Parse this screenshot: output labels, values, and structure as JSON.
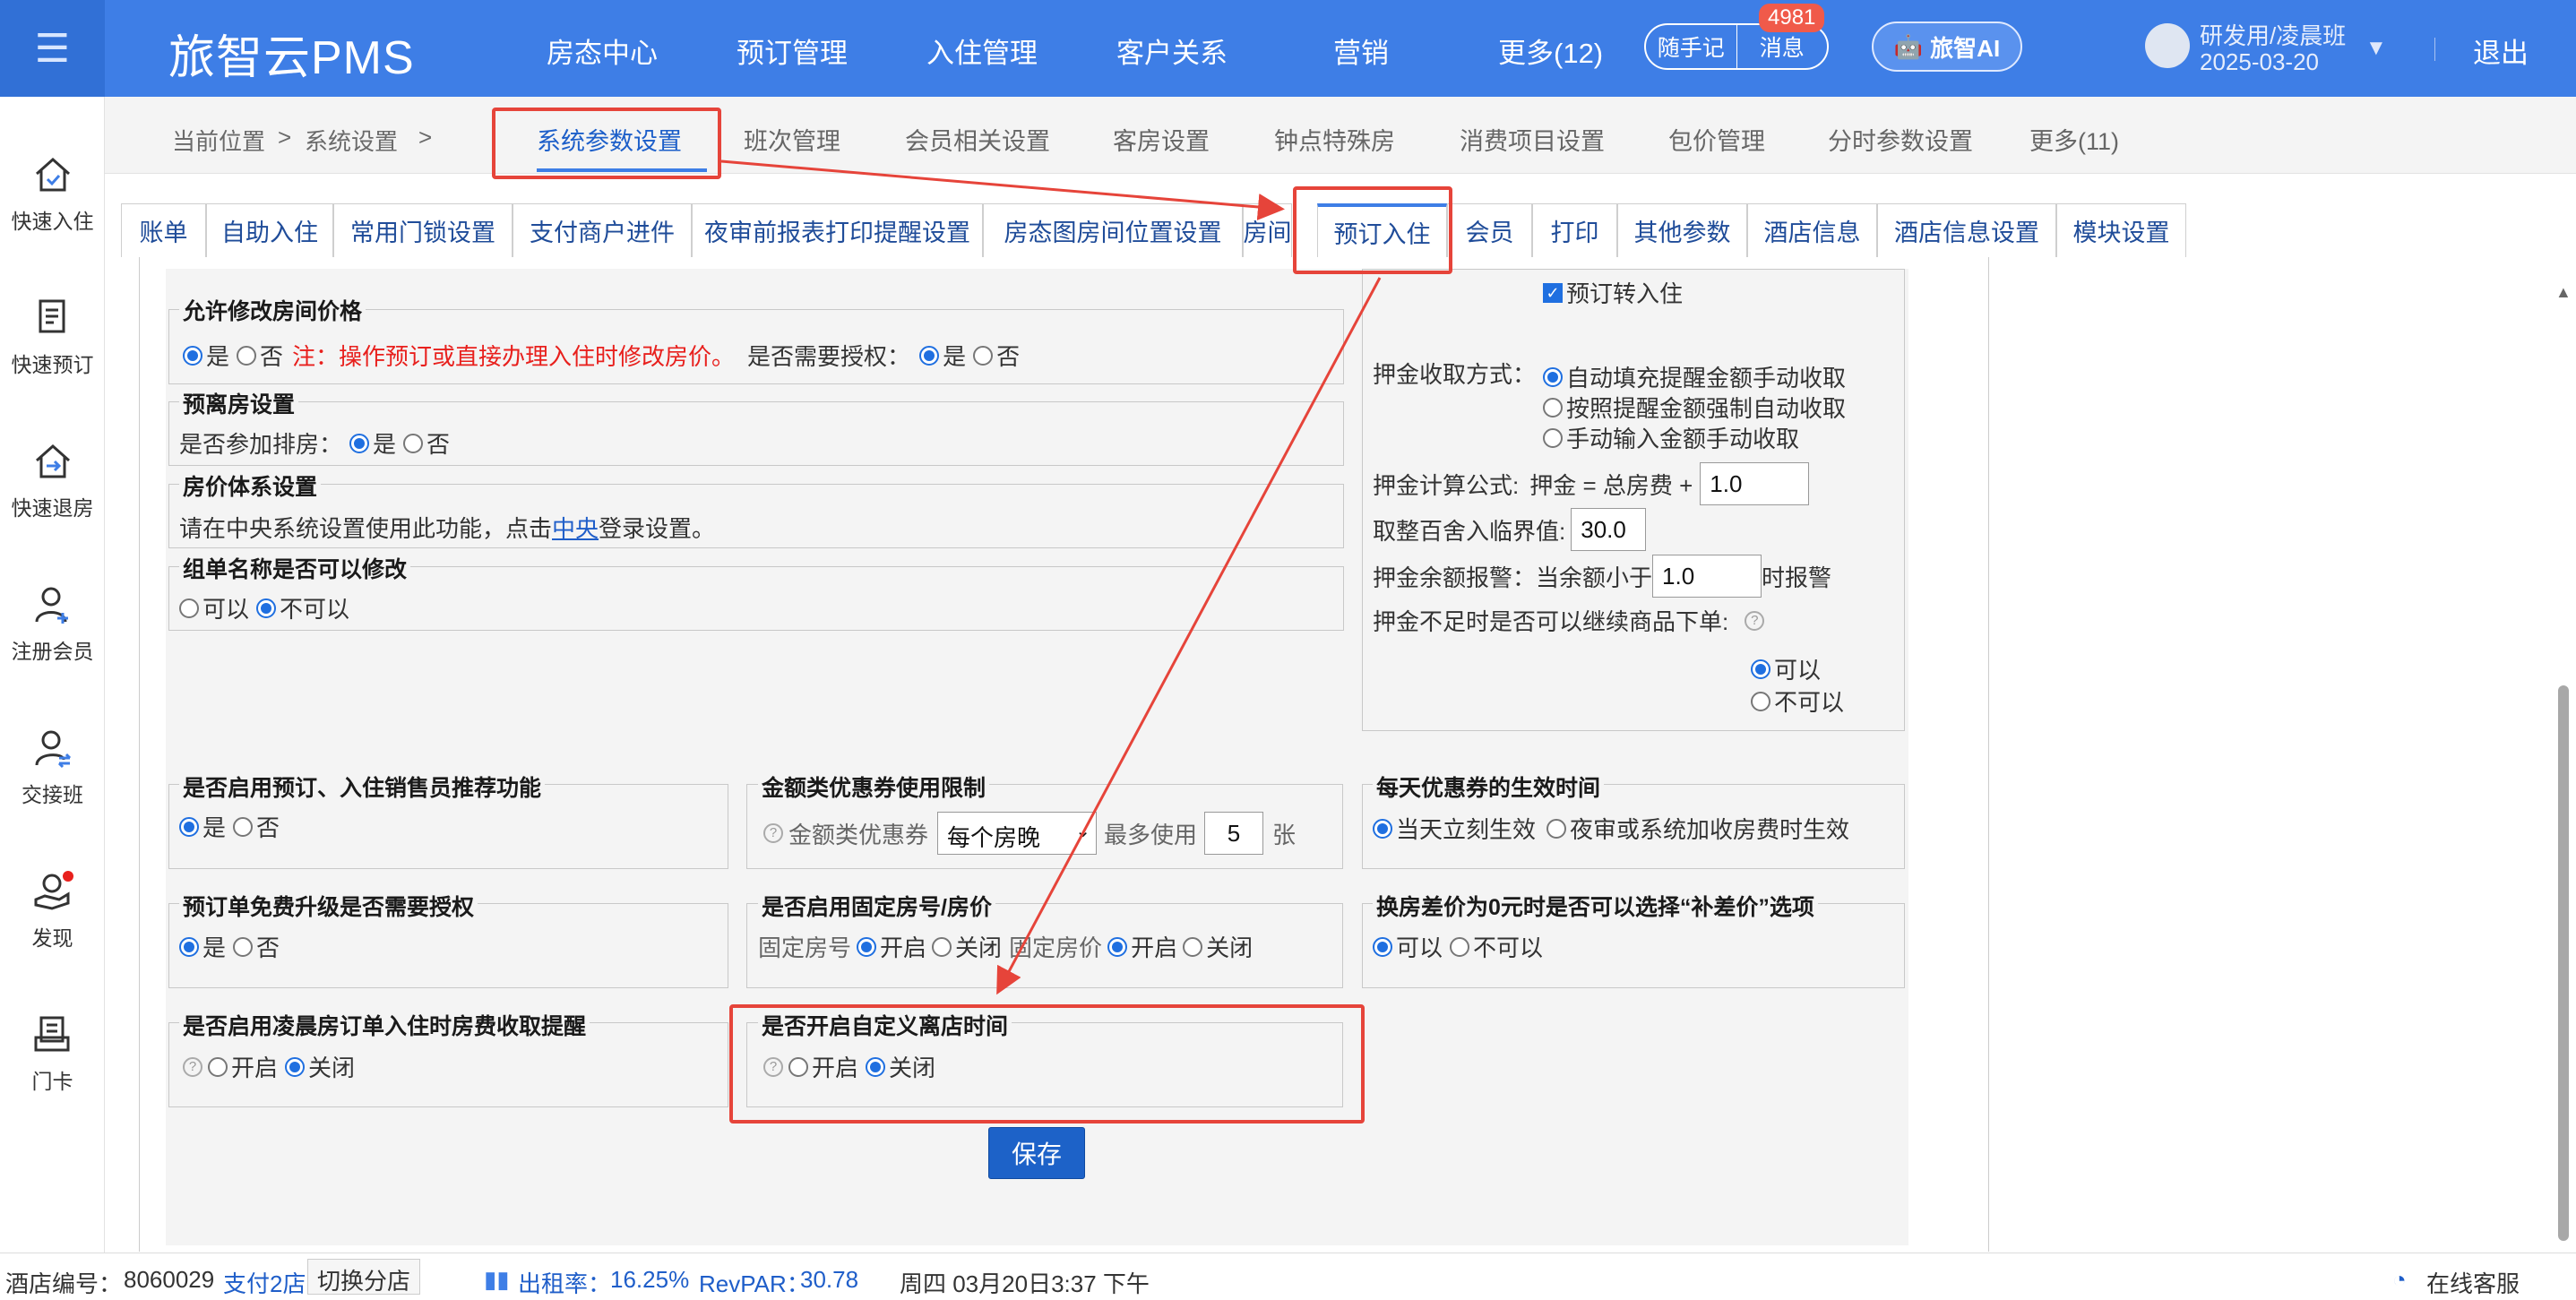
{
  "header": {
    "logo": "旅智云PMS",
    "nav": [
      "房态中心",
      "预订管理",
      "入住管理",
      "客户关系",
      "营销",
      "更多(12)"
    ],
    "memo_label": "随手记",
    "messages_label": "消息",
    "messages_count": "4981",
    "ai_label": "旅智AI",
    "user_name": "研发用/凌晨班",
    "user_date": "2025-03-20",
    "logout": "退出"
  },
  "sidebar": [
    "快速入住",
    "快速预订",
    "快速退房",
    "注册会员",
    "交接班",
    "发现",
    "门卡"
  ],
  "breadcrumb": {
    "current": "当前位置",
    "sep": ">",
    "system": "系统设置",
    "sep2": ">"
  },
  "top_tabs": [
    "系统参数设置",
    "班次管理",
    "会员相关设置",
    "客房设置",
    "钟点特殊房",
    "消费项目设置",
    "包价管理",
    "分时参数设置",
    "更多(11)"
  ],
  "sub_tabs": [
    "账单",
    "自助入住",
    "常用门锁设置",
    "支付商户进件",
    "夜审前报表打印提醒设置",
    "房态图房间位置设置",
    "房间",
    "预订入住",
    "会员",
    "打印",
    "其他参数",
    "酒店信息",
    "酒店信息设置",
    "模块设置"
  ],
  "settings": {
    "price_mod": {
      "title": "允许修改房间价格",
      "yes": "是",
      "no": "否",
      "note": "注：操作预订或直接办理入住时修改房价。",
      "auth_q": "是否需要授权：",
      "auth_yes": "是",
      "auth_no": "否"
    },
    "pre_departure": {
      "title": "预离房设置",
      "q": "是否参加排房：",
      "yes": "是",
      "no": "否"
    },
    "price_system": {
      "title": "房价体系设置",
      "text_a": "请在中央系统设置使用此功能，点击",
      "link": "中央",
      "text_b": "登录设置。"
    },
    "group_name": {
      "title": "组单名称是否可以修改",
      "yes": "可以",
      "no": "不可以"
    },
    "reserve_to_checkin": "预订转入住",
    "deposit": {
      "method_label": "押金收取方式：",
      "opt1": "自动填充提醒金额手动收取",
      "opt2": "按照提醒金额强制自动收取",
      "opt3": "手动输入金额手动收取",
      "formula_label": "押金计算公式:",
      "formula_text": "押金 = 总房费 +",
      "formula_value": "1.0",
      "rounding_label": "取整百舍入临界值:",
      "rounding_value": "30.0",
      "alert_label": "押金余额报警：当余额小于",
      "alert_value": "1.0",
      "alert_suffix": "时报警",
      "insufficient_label": "押金不足时是否可以继续商品下单:",
      "can": "可以",
      "cannot": "不可以"
    },
    "salesperson": {
      "title": "是否启用预订、入住销售员推荐功能",
      "yes": "是",
      "no": "否"
    },
    "coupon_limit": {
      "title": "金额类优惠券使用限制",
      "label": "金额类优惠券",
      "select": "每个房晚",
      "max_label": "最多使用",
      "max_value": "5",
      "unit": "张"
    },
    "daily_coupon": {
      "title": "每天优惠券的生效时间",
      "opt1": "当天立刻生效",
      "opt2": "夜审或系统加收房费时生效"
    },
    "upgrade_auth": {
      "title": "预订单免费升级是否需要授权",
      "yes": "是",
      "no": "否"
    },
    "fixed_room": {
      "title": "是否启用固定房号/房价",
      "room_label": "固定房号",
      "price_label": "固定房价",
      "on": "开启",
      "off": "关闭"
    },
    "zero_diff": {
      "title": "换房差价为0元时是否可以选择“补差价”选项",
      "yes": "可以",
      "no": "不可以"
    },
    "early_morning": {
      "title": "是否启用凌晨房订单入住时房费收取提醒",
      "on": "开启",
      "off": "关闭"
    },
    "custom_checkout": {
      "title": "是否开启自定义离店时间",
      "on": "开启",
      "off": "关闭"
    },
    "save": "保存"
  },
  "status": {
    "hotel_label": "酒店编号：",
    "hotel_no": "8060029",
    "branch": "支付2店",
    "switch": "切换分店",
    "occupancy_label": "出租率：",
    "occupancy": "16.25%",
    "revpar_label": "RevPAR：",
    "revpar": "30.78",
    "datetime": "周四 03月20日3:37 下午",
    "support": "在线客服"
  },
  "colors": {
    "topbar": "#3e7ee6",
    "highlight": "#e6443a",
    "save": "#1d62c8"
  }
}
